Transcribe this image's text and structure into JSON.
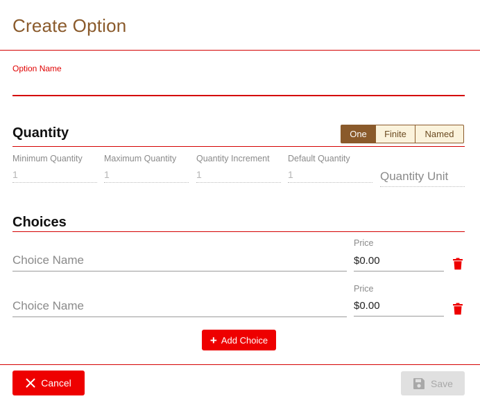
{
  "dialog": {
    "title": "Create Option"
  },
  "option_name": {
    "label": "Option Name",
    "value": ""
  },
  "quantity": {
    "title": "Quantity",
    "modes": [
      {
        "label": "One",
        "active": true
      },
      {
        "label": "Finite",
        "active": false
      },
      {
        "label": "Named",
        "active": false
      }
    ],
    "fields": [
      {
        "label": "Minimum Quantity",
        "value": "1"
      },
      {
        "label": "Maximum Quantity",
        "value": "1"
      },
      {
        "label": "Quantity Increment",
        "value": "1"
      },
      {
        "label": "Default Quantity",
        "value": "1"
      }
    ],
    "unit_placeholder": "Quantity Unit"
  },
  "choices": {
    "title": "Choices",
    "items": [
      {
        "name_placeholder": "Choice Name",
        "price_label": "Price",
        "price": "$0.00"
      },
      {
        "name_placeholder": "Choice Name",
        "price_label": "Price",
        "price": "$0.00"
      }
    ],
    "add_label": "Add Choice"
  },
  "footer": {
    "cancel_label": "Cancel",
    "save_label": "Save",
    "save_enabled": false
  },
  "colors": {
    "brand": "#8a5a2b",
    "accent": "#ee0000",
    "segment_bg": "#fbf3dc",
    "disabled": "#e0e0e0"
  },
  "icons": {
    "delete": "trash-icon",
    "add": "plus-icon",
    "cancel": "close-icon",
    "save": "floppy-disk-icon"
  }
}
